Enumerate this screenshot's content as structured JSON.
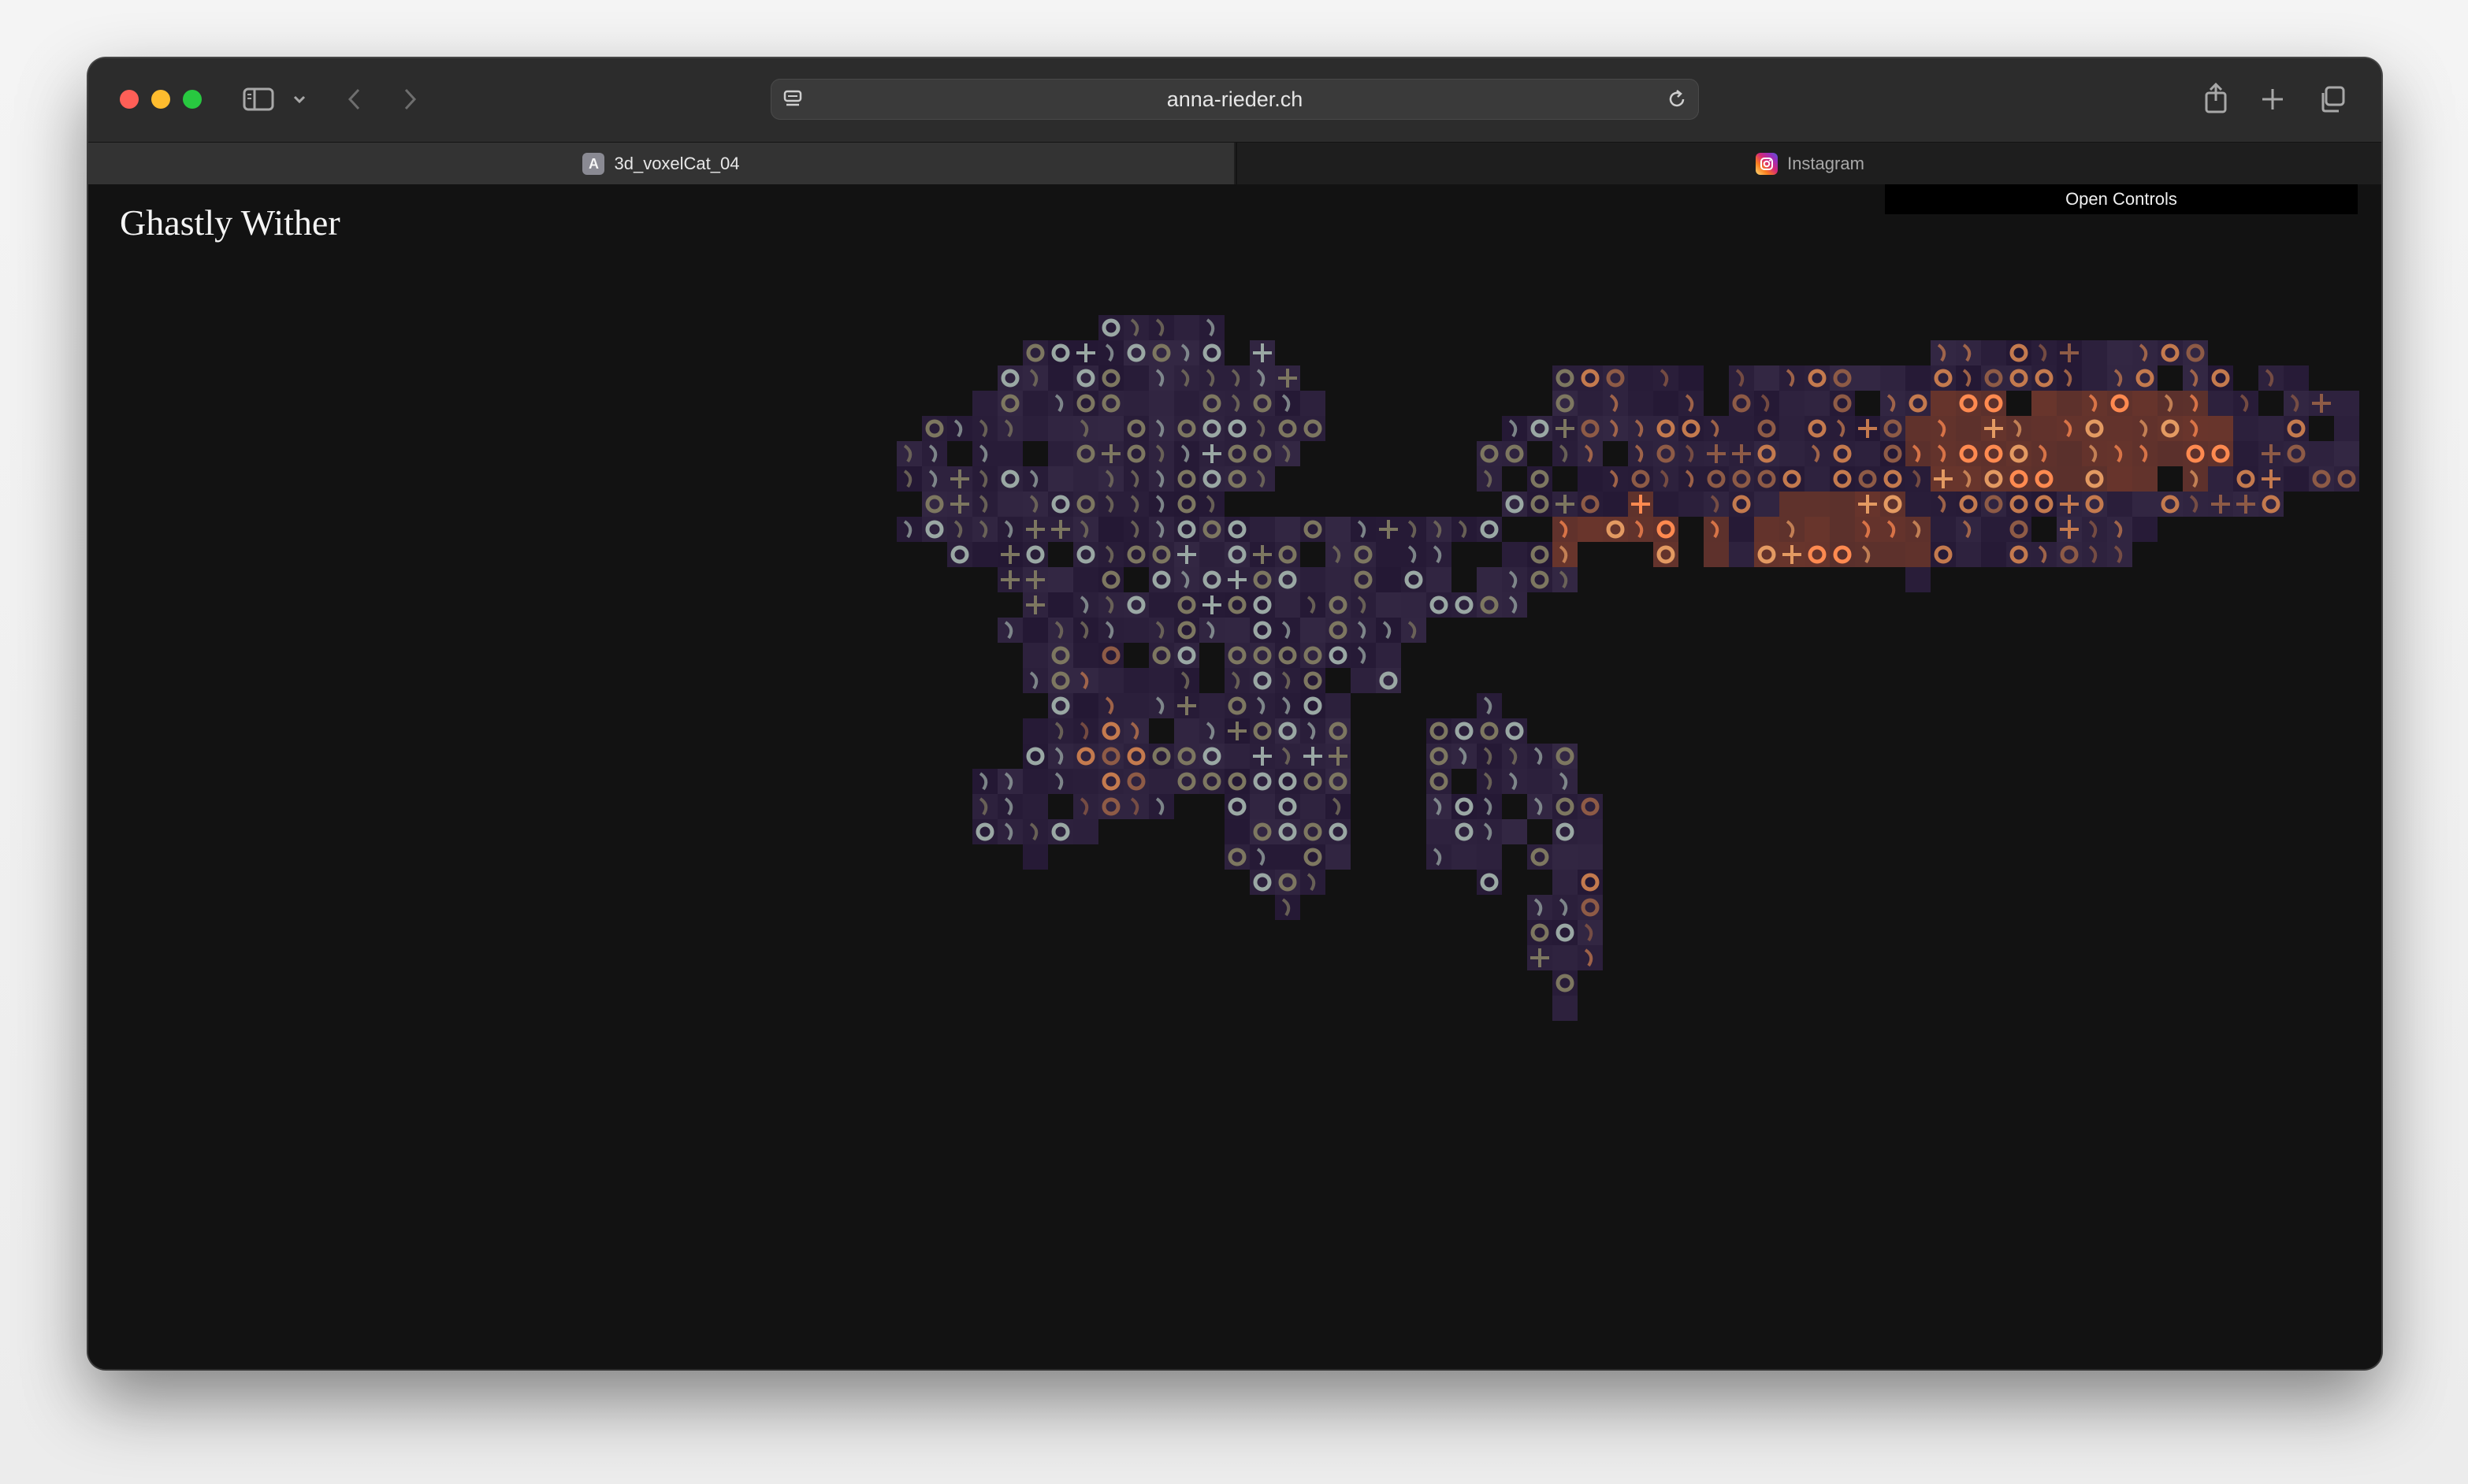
{
  "browser": {
    "address": {
      "url": "anna-rieder.ch"
    },
    "tabs": [
      {
        "label": "3d_voxelCat_04",
        "favicon_letter": "A",
        "active": true
      },
      {
        "label": "Instagram",
        "active": false
      }
    ]
  },
  "page": {
    "title": "Ghastly Wither",
    "controls_button": "Open Controls"
  },
  "colors": {
    "background": "#121212",
    "body_purple": "#2a2038",
    "glyph_cool": "#9aa8a4",
    "glyph_warm": "#e39a62",
    "glyph_hot": "#ff8a50"
  },
  "icons": {
    "sidebar": "sidebar-icon",
    "back": "chevron-left-icon",
    "forward": "chevron-right-icon",
    "reload": "reload-icon",
    "share": "share-icon",
    "new_tab": "plus-icon",
    "tab_overview": "tabs-icon"
  }
}
